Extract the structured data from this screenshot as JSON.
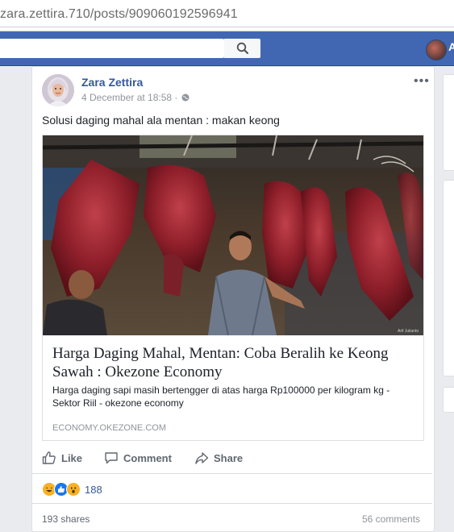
{
  "browser": {
    "url": "zara.zettira.710/posts/909060192596941"
  },
  "topbar": {
    "search_placeholder": "",
    "profile_name_fragment": "A"
  },
  "post": {
    "author": "Zara Zettira",
    "timestamp": "4 December at 18:58 · ",
    "privacy_icon": "globe-icon",
    "more_label": "•••",
    "text": "Solusi daging mahal ala mentan : makan keong",
    "link": {
      "image_caption": "Arif Julianto",
      "title": "Harga Daging Mahal, Mentan: Coba Beralih ke Keong Sawah : Okezone Economy",
      "description": "Harga daging sapi masih bertengger di atas harga Rp100000 per kilogram kg - Sektor Riil - okezone economy",
      "domain": "ECONOMY.OKEZONE.COM"
    },
    "actions": {
      "like": "Like",
      "comment": "Comment",
      "share": "Share"
    },
    "reactions": {
      "types": [
        "haha",
        "like",
        "wow"
      ],
      "count": "188"
    },
    "shares": "193 shares",
    "comments": "56 comments"
  },
  "colors": {
    "fb_blue": "#4267b2",
    "link_blue": "#365899",
    "gray_text": "#606770"
  }
}
